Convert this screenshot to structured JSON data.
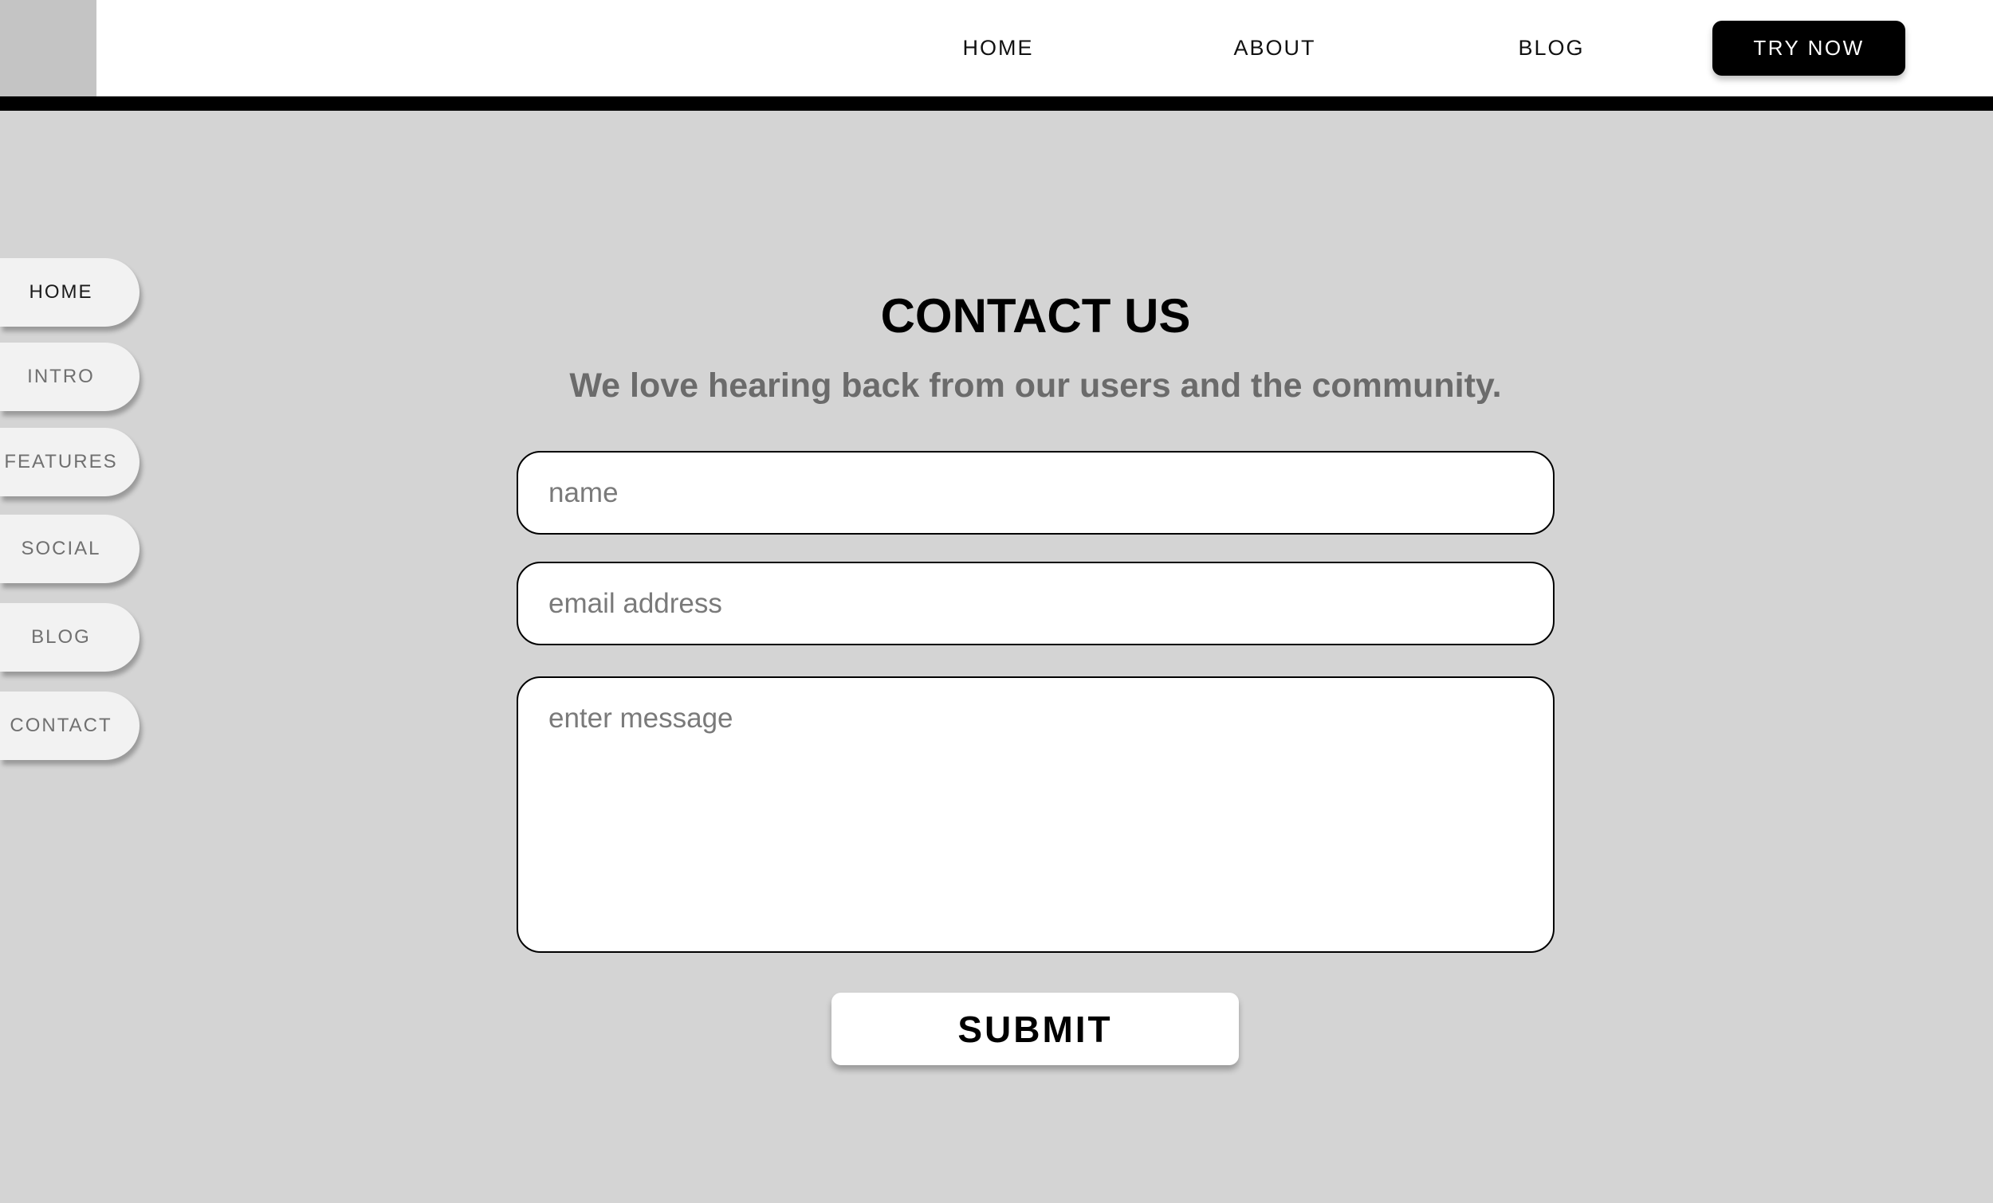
{
  "header": {
    "nav": [
      {
        "label": "HOME"
      },
      {
        "label": "ABOUT"
      },
      {
        "label": "BLOG"
      }
    ],
    "cta_label": "TRY NOW"
  },
  "sidebar": {
    "items": [
      {
        "label": "HOME",
        "active": true
      },
      {
        "label": "INTRO"
      },
      {
        "label": "FEATURES"
      },
      {
        "label": "SOCIAL"
      },
      {
        "label": "BLOG"
      },
      {
        "label": "CONTACT"
      }
    ]
  },
  "contact": {
    "title": "CONTACT US",
    "subtitle": "We love hearing back from our users and the community.",
    "name_placeholder": "name",
    "email_placeholder": "email address",
    "message_placeholder": "enter message",
    "submit_label": "SUBMIT"
  },
  "colors": {
    "background": "#d4d4d4",
    "header_bg": "#ffffff",
    "accent": "#000000",
    "logo_placeholder": "#c4c4c4",
    "subtitle_text": "#6b6b6b"
  }
}
